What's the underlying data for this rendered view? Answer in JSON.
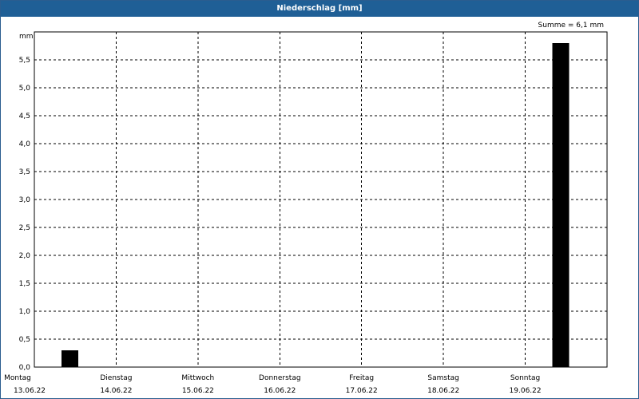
{
  "window": {
    "title": "Niederschlag [mm]"
  },
  "chart_data": {
    "type": "bar",
    "title": "Niederschlag [mm]",
    "ylabel": "mm",
    "summary": "Summe = 6,1 mm",
    "ylim": [
      0,
      6.0
    ],
    "yticks": [
      {
        "value": 0.0,
        "label": "0,0"
      },
      {
        "value": 0.5,
        "label": "0,5"
      },
      {
        "value": 1.0,
        "label": "1,0"
      },
      {
        "value": 1.5,
        "label": "1,5"
      },
      {
        "value": 2.0,
        "label": "2,0"
      },
      {
        "value": 2.5,
        "label": "2,5"
      },
      {
        "value": 3.0,
        "label": "3,0"
      },
      {
        "value": 3.5,
        "label": "3,5"
      },
      {
        "value": 4.0,
        "label": "4,0"
      },
      {
        "value": 4.5,
        "label": "4,5"
      },
      {
        "value": 5.0,
        "label": "5,0"
      },
      {
        "value": 5.5,
        "label": "5,5"
      }
    ],
    "categories": [
      {
        "day": "Montag",
        "date": "13.06.22"
      },
      {
        "day": "Dienstag",
        "date": "14.06.22"
      },
      {
        "day": "Mittwoch",
        "date": "15.06.22"
      },
      {
        "day": "Donnerstag",
        "date": "16.06.22"
      },
      {
        "day": "Freitag",
        "date": "17.06.22"
      },
      {
        "day": "Samstag",
        "date": "18.06.22"
      },
      {
        "day": "Sonntag",
        "date": "19.06.22"
      }
    ],
    "values": [
      0.3,
      0,
      0,
      0,
      0,
      0,
      5.8
    ],
    "grid": true,
    "bar_color": "#000000"
  }
}
